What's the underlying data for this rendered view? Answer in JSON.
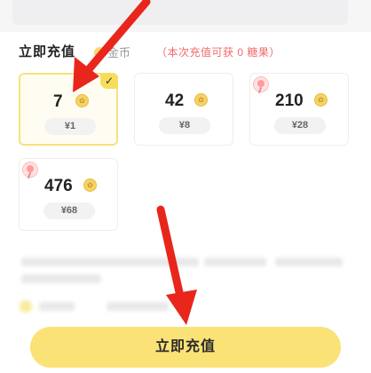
{
  "header": {
    "section_title": "立即充值",
    "balance_text": "金币",
    "promo_text": "（本次充值可获 0 糖果）"
  },
  "packages": [
    {
      "amount": "7",
      "price": "¥1",
      "selected": true,
      "candy_badge": false
    },
    {
      "amount": "42",
      "price": "¥8",
      "selected": false,
      "candy_badge": false
    },
    {
      "amount": "210",
      "price": "¥28",
      "selected": false,
      "candy_badge": true
    },
    {
      "amount": "476",
      "price": "¥68",
      "selected": false,
      "candy_badge": true
    }
  ],
  "check_mark": "✓",
  "coin_glyph": "✿",
  "cta": {
    "label": "立即充值"
  },
  "colors": {
    "accent": "#fbe276",
    "selected_border": "#f7e27a",
    "promo": "#f06a6a",
    "arrow": "#e8261c"
  }
}
